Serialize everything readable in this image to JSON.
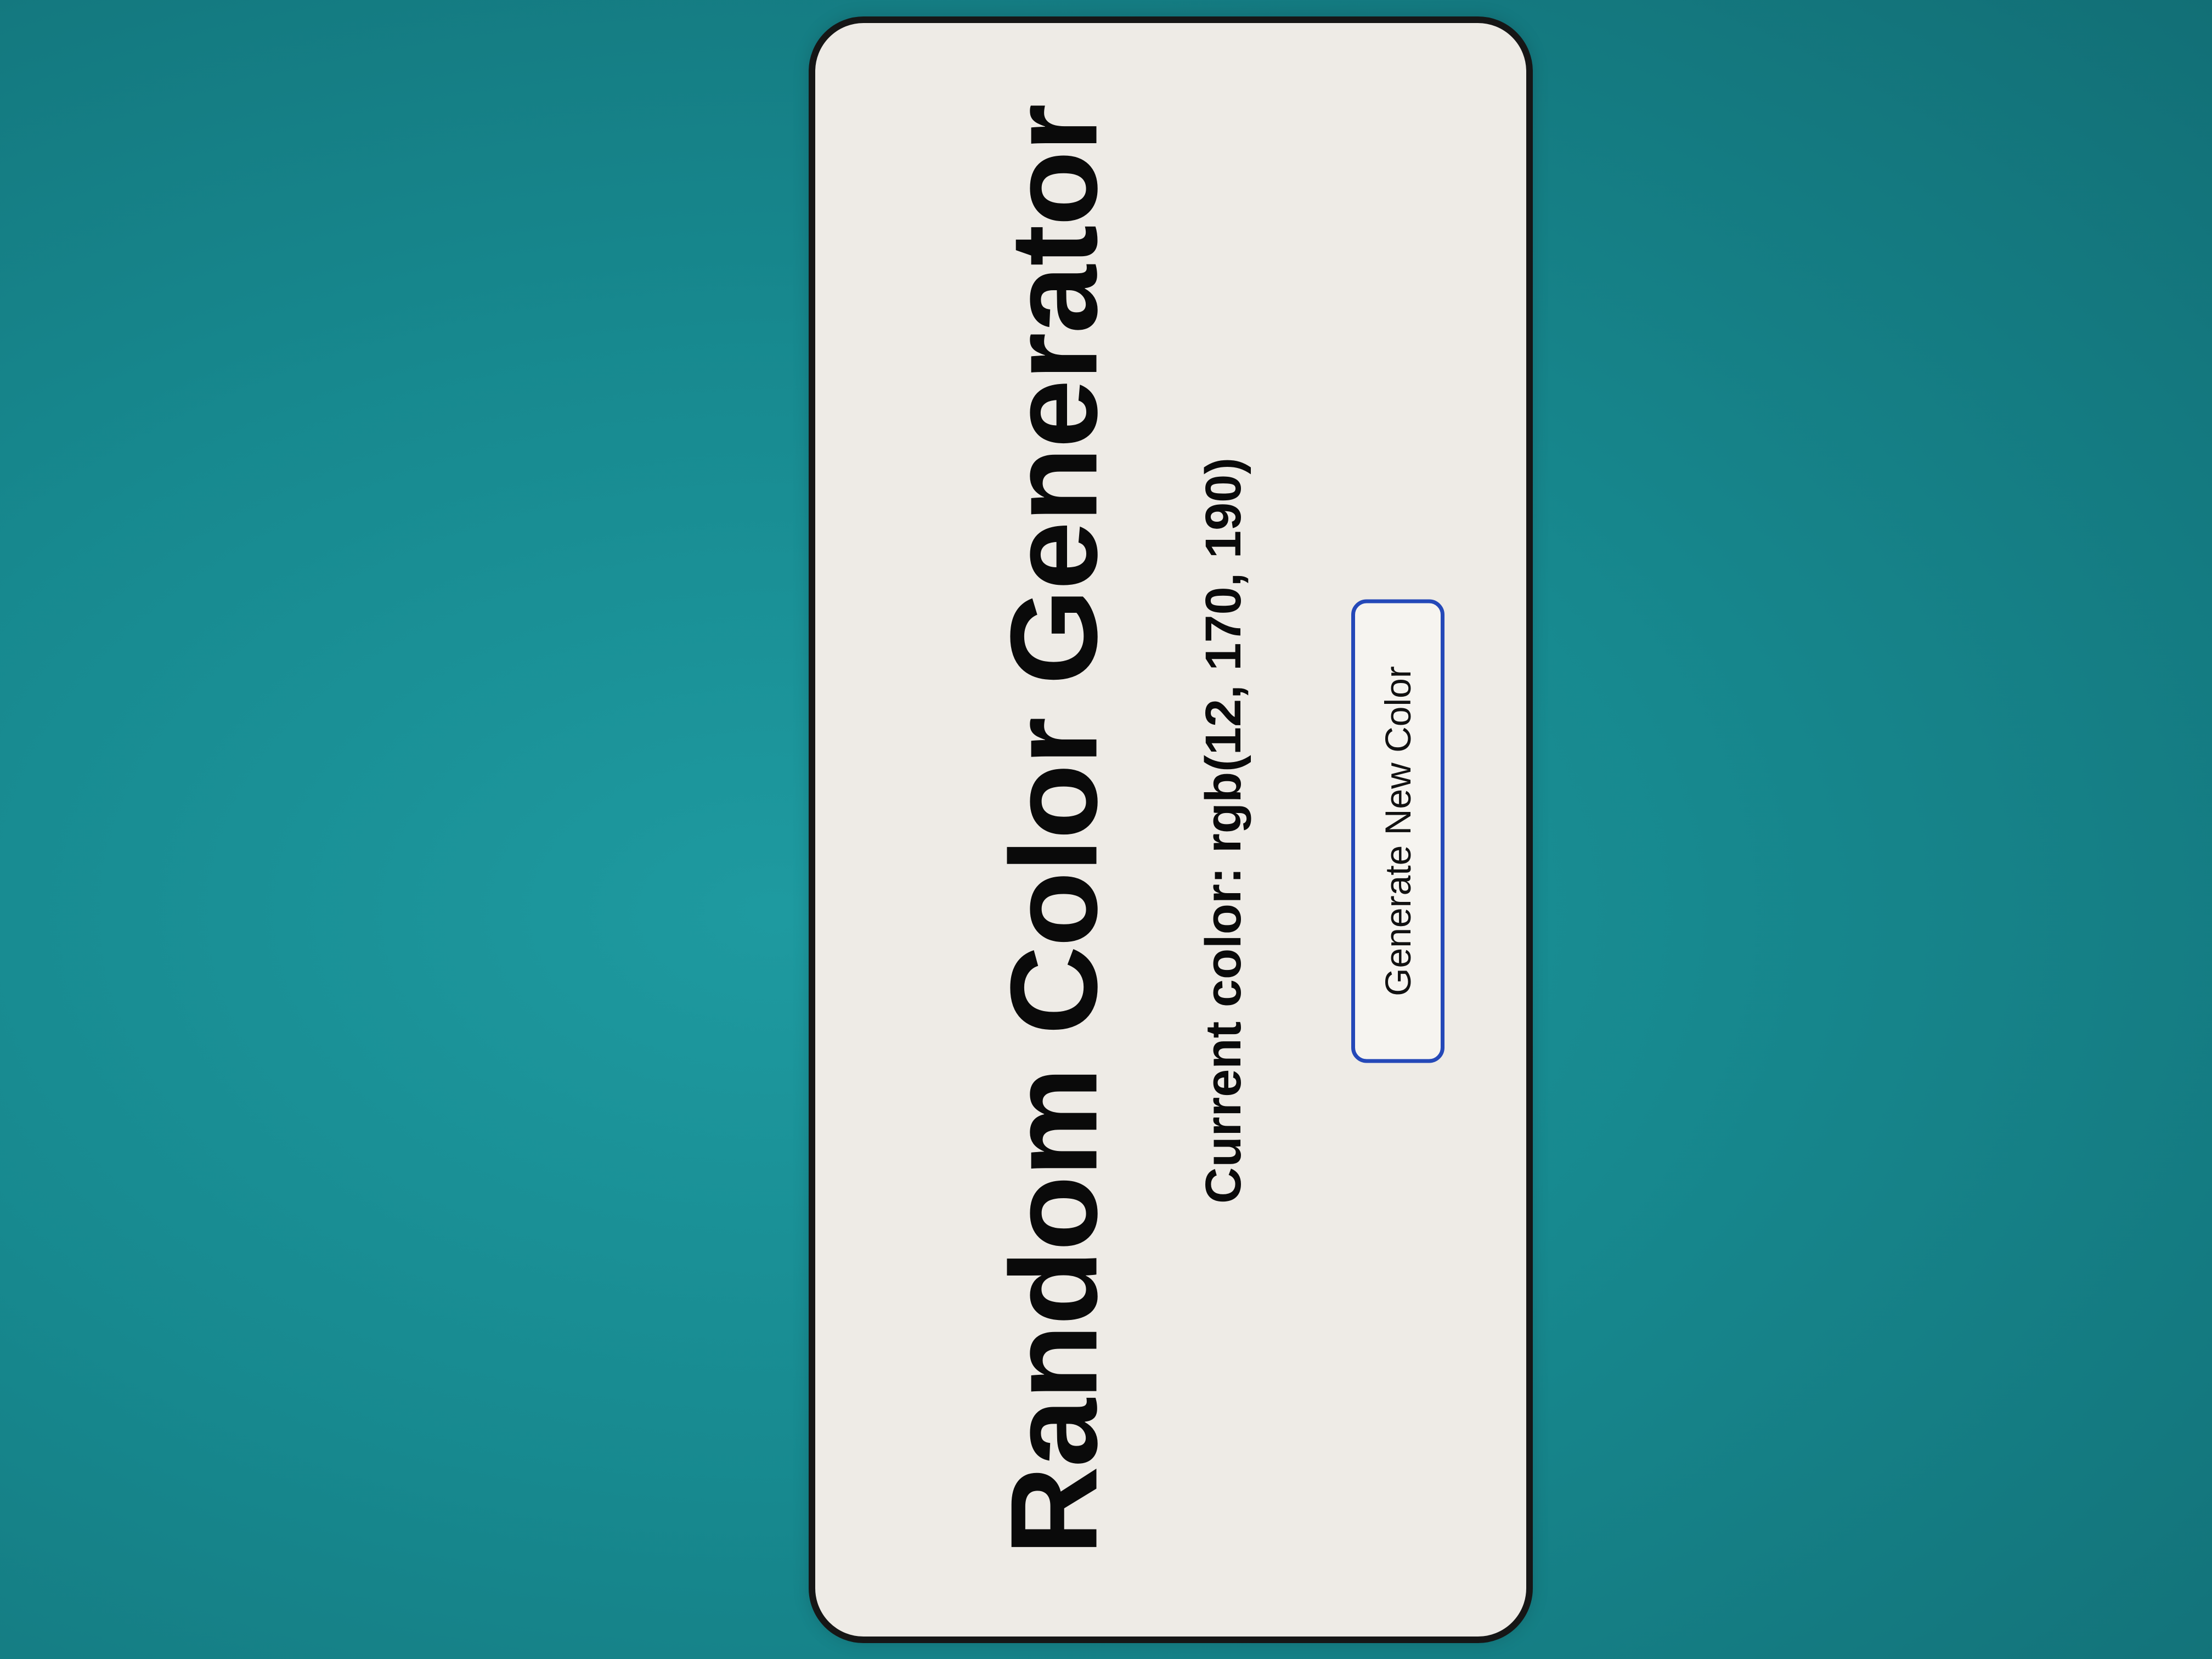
{
  "app": {
    "title": "Random Color Generator",
    "current_color_label": "Current color: rgb(12, 170, 190)",
    "generate_button_label": "Generate New Color"
  },
  "colors": {
    "background": "#1e9aa0",
    "card_background": "#eeebe6",
    "card_border": "#161616",
    "button_border": "#2448b8",
    "text": "#0a0a0a"
  }
}
